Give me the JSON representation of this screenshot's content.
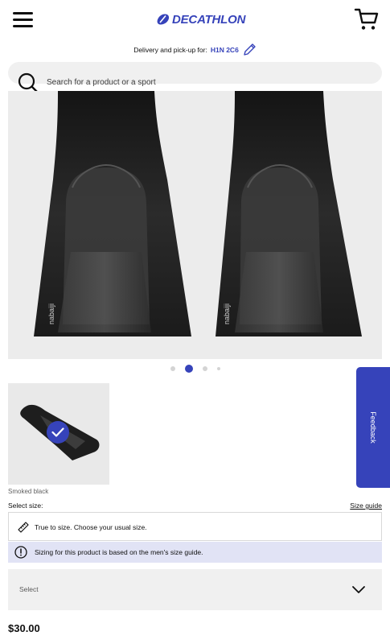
{
  "header": {
    "menu_icon": "hamburger-menu-icon",
    "brand": "DECATHLON",
    "cart_icon": "shopping-cart-icon",
    "accent_color": "#3643ba"
  },
  "delivery": {
    "label": "Delivery and pick-up for:",
    "postal_code": "H1N 2C6",
    "edit_icon": "pencil-icon"
  },
  "search": {
    "placeholder": "Search for a product or a sport",
    "icon": "search-icon"
  },
  "gallery": {
    "image_count": 4,
    "active_index": 1,
    "product_brand_mark": "nabaiji"
  },
  "color_selector": {
    "selected_color": "Smoked black",
    "selected": true
  },
  "size": {
    "label": "Select size:",
    "guide_link": "Size guide",
    "fit_note": "True to size. Choose your usual size.",
    "info_note": "Sizing for this product is based on the men's size guide.",
    "select_value": "Select"
  },
  "price": "$30.00",
  "feedback_tab": "Feedback"
}
